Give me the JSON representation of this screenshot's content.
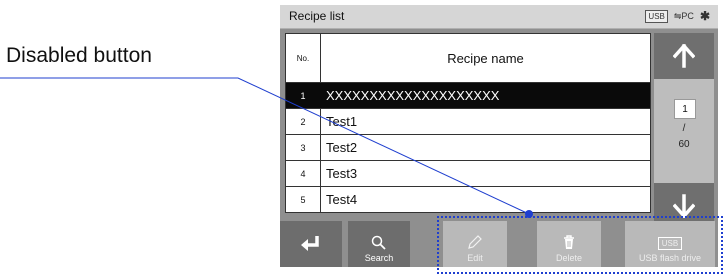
{
  "callout": {
    "label": "Disabled button"
  },
  "title_bar": {
    "title": "Recipe list",
    "status_usb": "USB",
    "status_pc": "PC",
    "status_bt": "✱"
  },
  "table": {
    "header_no": "No.",
    "header_name": "Recipe name",
    "rows": [
      {
        "no": "1",
        "name": "XXXXXXXXXXXXXXXXXXXX",
        "selected": true
      },
      {
        "no": "2",
        "name": "Test1"
      },
      {
        "no": "3",
        "name": "Test2"
      },
      {
        "no": "4",
        "name": "Test3"
      },
      {
        "no": "5",
        "name": "Test4"
      }
    ]
  },
  "pager": {
    "current": "1",
    "separator": "/",
    "total": "60"
  },
  "toolbar": {
    "search_label": "Search",
    "edit_label": "Edit",
    "delete_label": "Delete",
    "usb_chip": "USB",
    "usb_label": "USB flash drive",
    "disabled": [
      "Edit",
      "Delete",
      "USB flash drive"
    ]
  },
  "colors": {
    "button": "#6d6d6d",
    "button_disabled": "#b9b9b9",
    "selected_row": "#0a0a0a",
    "callout_line": "#1f3fcf"
  },
  "icons": [
    "back-icon",
    "search-icon",
    "edit-icon",
    "delete-icon",
    "usb-icon",
    "arrow-up-icon",
    "arrow-down-icon",
    "bluetooth-icon"
  ]
}
